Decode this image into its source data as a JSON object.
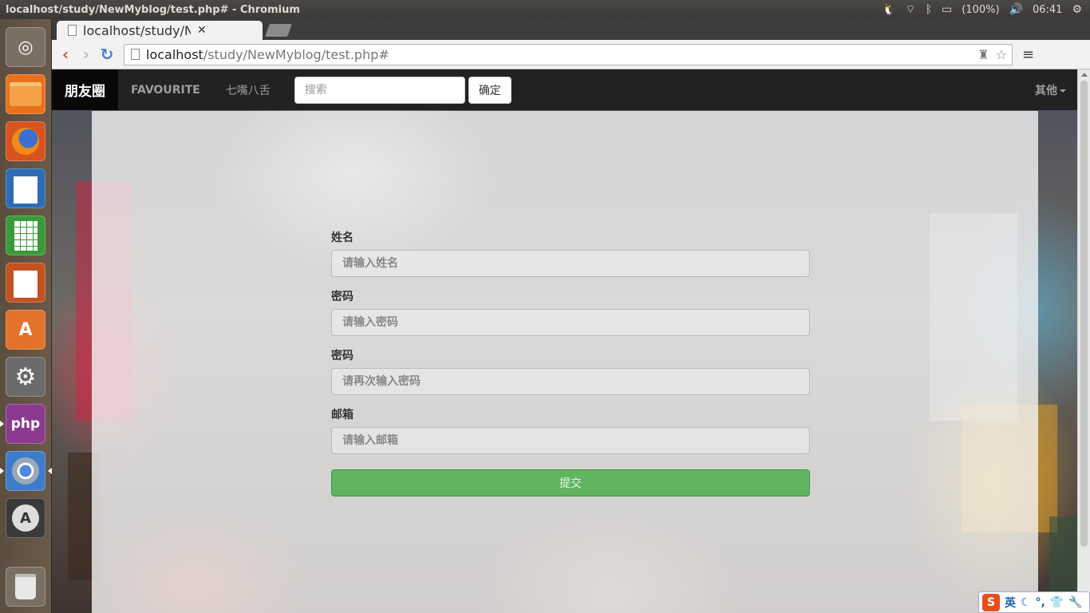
{
  "os_panel": {
    "window_title": "localhost/study/NewMyblog/test.php# - Chromium",
    "battery": "(100%)",
    "clock": "06:41"
  },
  "launcher": {
    "apps": [
      {
        "name": "dash-icon",
        "glyph": "◎",
        "color": "#7a6f63"
      },
      {
        "name": "files-icon",
        "glyph": "",
        "color": "#e8721c"
      },
      {
        "name": "firefox-icon",
        "glyph": "",
        "color": "#d9531e"
      },
      {
        "name": "writer-icon",
        "glyph": "",
        "color": "#2e6cb5"
      },
      {
        "name": "calc-icon",
        "glyph": "",
        "color": "#3a9a3a"
      },
      {
        "name": "impress-icon",
        "glyph": "",
        "color": "#c2521f"
      },
      {
        "name": "software-center-icon",
        "glyph": "A",
        "color": "#e2722a"
      },
      {
        "name": "system-settings-icon",
        "glyph": "⚙",
        "color": "#6b6b6b"
      },
      {
        "name": "php-icon",
        "glyph": "php",
        "color": "#8a3b8f"
      },
      {
        "name": "chromium-icon",
        "glyph": "",
        "color": "#3d7cc9"
      },
      {
        "name": "software-updater-icon",
        "glyph": "A",
        "color": "#3a3a3a"
      },
      {
        "name": "trash-icon",
        "glyph": "",
        "color": "#7a6f63"
      }
    ]
  },
  "browser": {
    "tab_title": "localhost/study/N",
    "url_host": "localhost",
    "url_path": "/study/NewMyblog/test.php#"
  },
  "navbar": {
    "brand": "朋友圈",
    "links": [
      "FAVOURITE",
      "七嘴八舌"
    ],
    "search_placeholder": "搜索",
    "search_button": "确定",
    "dropdown_label": "其他"
  },
  "form": {
    "fields": [
      {
        "label": "姓名",
        "placeholder": "请输入姓名",
        "type": "text"
      },
      {
        "label": "密码",
        "placeholder": "请输入密码",
        "type": "password"
      },
      {
        "label": "密码",
        "placeholder": "请再次输入密码",
        "type": "password"
      },
      {
        "label": "邮箱",
        "placeholder": "请输入邮箱",
        "type": "email"
      }
    ],
    "submit_label": "提交"
  },
  "ime": {
    "mode": "英"
  },
  "colors": {
    "navbar_bg": "#222222",
    "brand_bg": "#080808",
    "submit_green": "#4cae4c",
    "panel_overlay": "rgba(245,245,245,0.80)"
  }
}
